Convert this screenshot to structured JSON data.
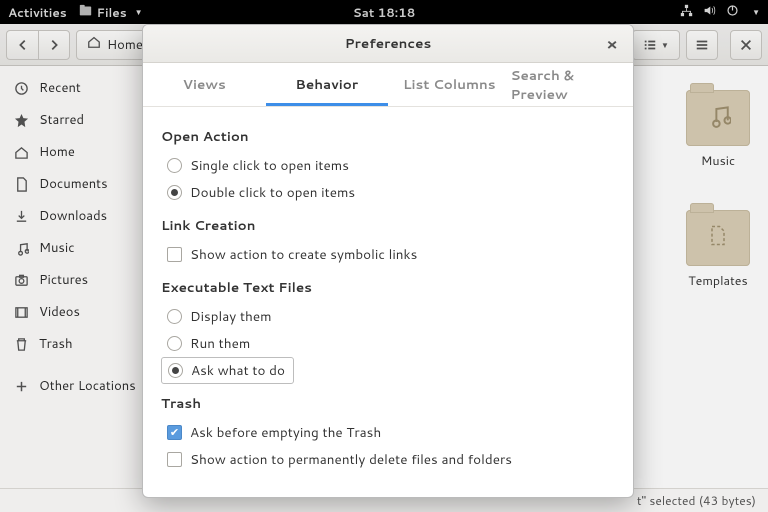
{
  "topbar": {
    "activities": "Activities",
    "app_name": "Files",
    "clock": "Sat 18:18"
  },
  "headerbar": {
    "path_label": "Home"
  },
  "sidebar": {
    "items": [
      {
        "label": "Recent"
      },
      {
        "label": "Starred"
      },
      {
        "label": "Home"
      },
      {
        "label": "Documents"
      },
      {
        "label": "Downloads"
      },
      {
        "label": "Music"
      },
      {
        "label": "Pictures"
      },
      {
        "label": "Videos"
      },
      {
        "label": "Trash"
      },
      {
        "label": "Other Locations"
      }
    ]
  },
  "main": {
    "folders": [
      {
        "label": "Music"
      },
      {
        "label": "Templates"
      }
    ]
  },
  "statusbar": {
    "text": "t\" selected  (43 bytes)"
  },
  "dialog": {
    "title": "Preferences",
    "tabs": {
      "views": "Views",
      "behavior": "Behavior",
      "list_columns": "List Columns",
      "search_preview": "Search & Preview"
    },
    "sections": {
      "open_action": {
        "title": "Open Action",
        "single": "Single click to open items",
        "double": "Double click to open items"
      },
      "link_creation": {
        "title": "Link Creation",
        "symlinks": "Show action to create symbolic links"
      },
      "exec": {
        "title": "Executable Text Files",
        "display": "Display them",
        "run": "Run them",
        "ask": "Ask what to do"
      },
      "trash": {
        "title": "Trash",
        "ask_empty": "Ask before emptying the Trash",
        "perm_delete": "Show action to permanently delete files and folders"
      }
    }
  }
}
